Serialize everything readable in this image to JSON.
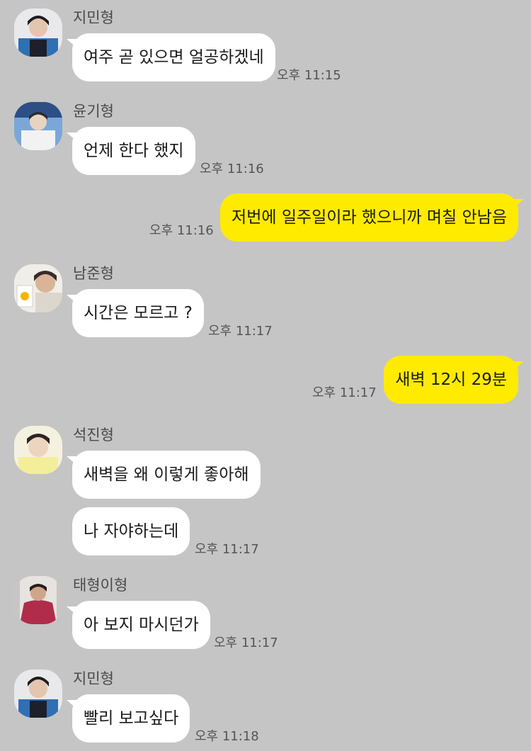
{
  "colors": {
    "background": "#c5c5c5",
    "incoming_bubble": "#ffffff",
    "outgoing_bubble": "#ffeb00",
    "sender_name": "#4a4a4a",
    "timestamp": "#555555"
  },
  "messages": [
    {
      "sender": "지민형",
      "avatar": "jimin-avatar",
      "text": "여주 곧 있으면 얼공하겠네",
      "time": "오후 11:15"
    },
    {
      "sender": "윤기형",
      "avatar": "yoongi-avatar",
      "text": "언제 한다 했지",
      "time": "오후 11:16"
    },
    {
      "text": "저번에 일주일이라 했으니까 며칠 안남음",
      "time": "오후 11:16"
    },
    {
      "sender": "남준형",
      "avatar": "namjoon-avatar",
      "text": "시간은 모르고 ?",
      "time": "오후 11:17"
    },
    {
      "text": "새벽 12시 29분",
      "time": "오후 11:17"
    },
    {
      "sender": "석진형",
      "avatar": "seokjin-avatar",
      "texts": [
        "새벽을 왜 이렇게 좋아해",
        "나 자야하는데"
      ],
      "time": "오후 11:17"
    },
    {
      "sender": "태형이형",
      "avatar": "taehyung-avatar",
      "text": "아 보지 마시던가",
      "time": "오후 11:17"
    },
    {
      "sender": "지민형",
      "avatar": "jimin-avatar",
      "text": "빨리 보고싶다",
      "time": "오후 11:18"
    }
  ]
}
